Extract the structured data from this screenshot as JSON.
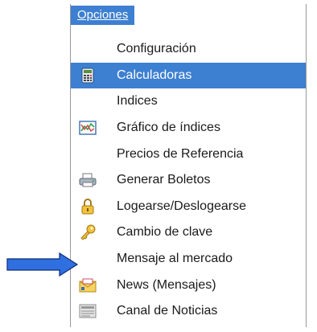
{
  "menu": {
    "title": "Opciones",
    "items": [
      {
        "label": "Configuración",
        "icon": null,
        "selected": false
      },
      {
        "label": "Calculadoras",
        "icon": "calculator-icon",
        "selected": true
      },
      {
        "label": "Indices",
        "icon": null,
        "selected": false
      },
      {
        "label": "Gráfico de índices",
        "icon": "chart-icon",
        "selected": false
      },
      {
        "label": "Precios de Referencia",
        "icon": null,
        "selected": false
      },
      {
        "label": "Generar Boletos",
        "icon": "printer-icon",
        "selected": false
      },
      {
        "label": "Logearse/Deslogearse",
        "icon": "lock-icon",
        "selected": false
      },
      {
        "label": "Cambio de clave",
        "icon": "key-icon",
        "selected": false
      },
      {
        "label": "Mensaje al mercado",
        "icon": null,
        "selected": false
      },
      {
        "label": "News (Mensajes)",
        "icon": "mail-icon",
        "selected": false
      },
      {
        "label": "Canal de Noticias",
        "icon": "news-icon",
        "selected": false
      }
    ]
  },
  "colors": {
    "highlight": "#3d7fd1",
    "arrow": "#2f6fe0",
    "text": "#1a1a1a"
  }
}
